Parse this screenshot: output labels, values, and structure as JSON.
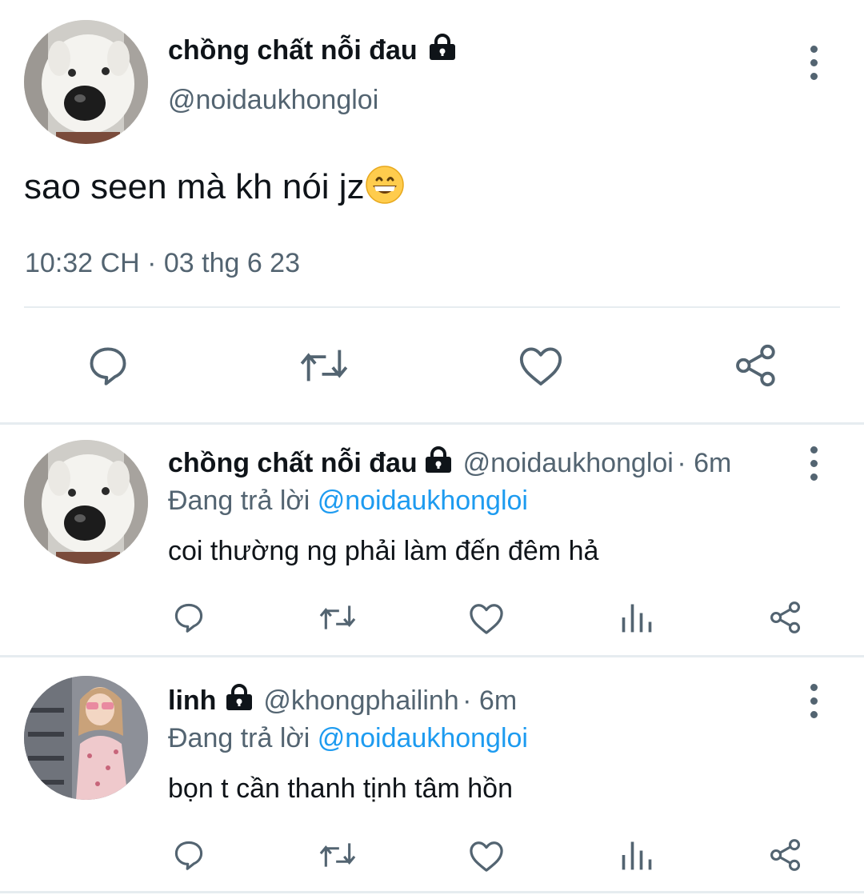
{
  "main_tweet": {
    "display_name": "chồng chất nỗi đau",
    "handle": "@noidaukhongloi",
    "text": "sao seen mà kh nói jz",
    "emoji": "😁",
    "timestamp": "10:32 CH · 03 thg 6 23",
    "actions": [
      "reply-icon",
      "retweet-icon",
      "like-icon",
      "share-icon"
    ]
  },
  "replies": [
    {
      "display_name": "chồng chất nỗi đau",
      "handle": "@noidaukhongloi",
      "time": "· 6m",
      "replying_prefix": "Đang trả lời",
      "replying_to": "@noidaukhongloi",
      "text": "coi thường ng phải làm đến đêm hả"
    },
    {
      "display_name": "linh",
      "handle": "@khongphailinh",
      "time": "· 6m",
      "replying_prefix": "Đang trả lời",
      "replying_to": "@noidaukhongloi",
      "text": "bọn t cần thanh tịnh tâm hồn"
    }
  ],
  "colors": {
    "text": "#0f1419",
    "muted": "#536471",
    "link": "#1d9bf0",
    "divider": "#e6ecf0"
  }
}
